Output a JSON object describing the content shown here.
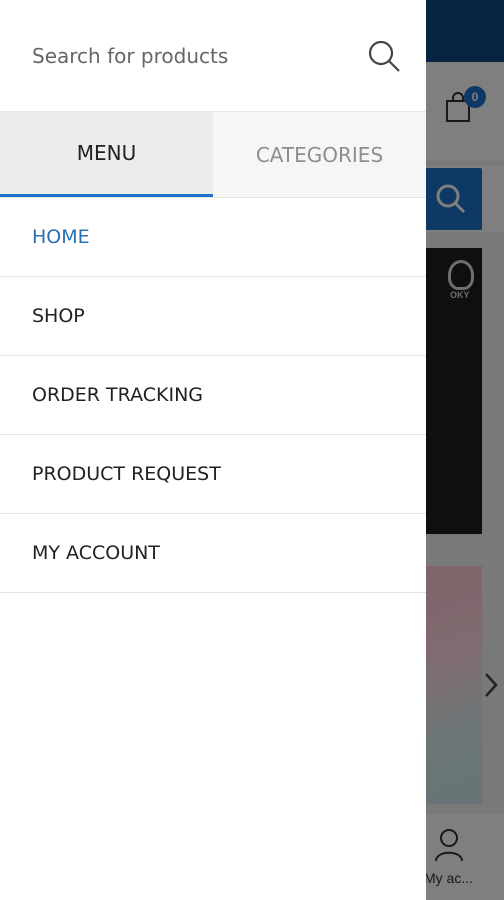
{
  "drawer": {
    "search": {
      "placeholder": "Search for products"
    },
    "tabs": [
      {
        "label": "MENU",
        "active": true
      },
      {
        "label": "CATEGORIES",
        "active": false
      }
    ],
    "menu_items": [
      {
        "label": "HOME",
        "active": true
      },
      {
        "label": "SHOP",
        "active": false
      },
      {
        "label": "ORDER TRACKING",
        "active": false
      },
      {
        "label": "PRODUCT REQUEST",
        "active": false
      },
      {
        "label": "MY ACCOUNT",
        "active": false
      }
    ]
  },
  "background": {
    "cart_count": "0",
    "banner_badge": "OKY",
    "bottom_nav_account_label": "My ac..."
  },
  "colors": {
    "accent": "#1a73c9",
    "active_link": "#2a6fb5",
    "topbar": "#0e4b86"
  }
}
